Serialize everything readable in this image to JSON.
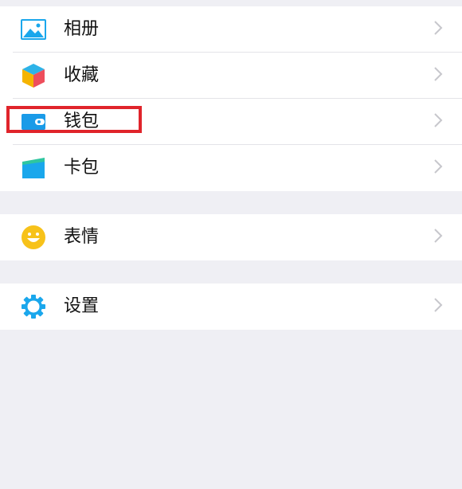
{
  "menu": {
    "group1": [
      {
        "id": "album",
        "label": "相册",
        "icon": "photo-album-icon"
      },
      {
        "id": "favorites",
        "label": "收藏",
        "icon": "cube-icon"
      },
      {
        "id": "wallet",
        "label": "钱包",
        "icon": "wallet-icon"
      },
      {
        "id": "cards",
        "label": "卡包",
        "icon": "card-folder-icon"
      }
    ],
    "group2": [
      {
        "id": "stickers",
        "label": "表情",
        "icon": "smiley-icon"
      }
    ],
    "group3": [
      {
        "id": "settings",
        "label": "设置",
        "icon": "gear-icon"
      }
    ]
  },
  "annotation": {
    "target": "wallet",
    "color": "#e0242b"
  },
  "colors": {
    "background": "#efeff4",
    "row": "#ffffff",
    "chevron": "#c7c7cc"
  }
}
